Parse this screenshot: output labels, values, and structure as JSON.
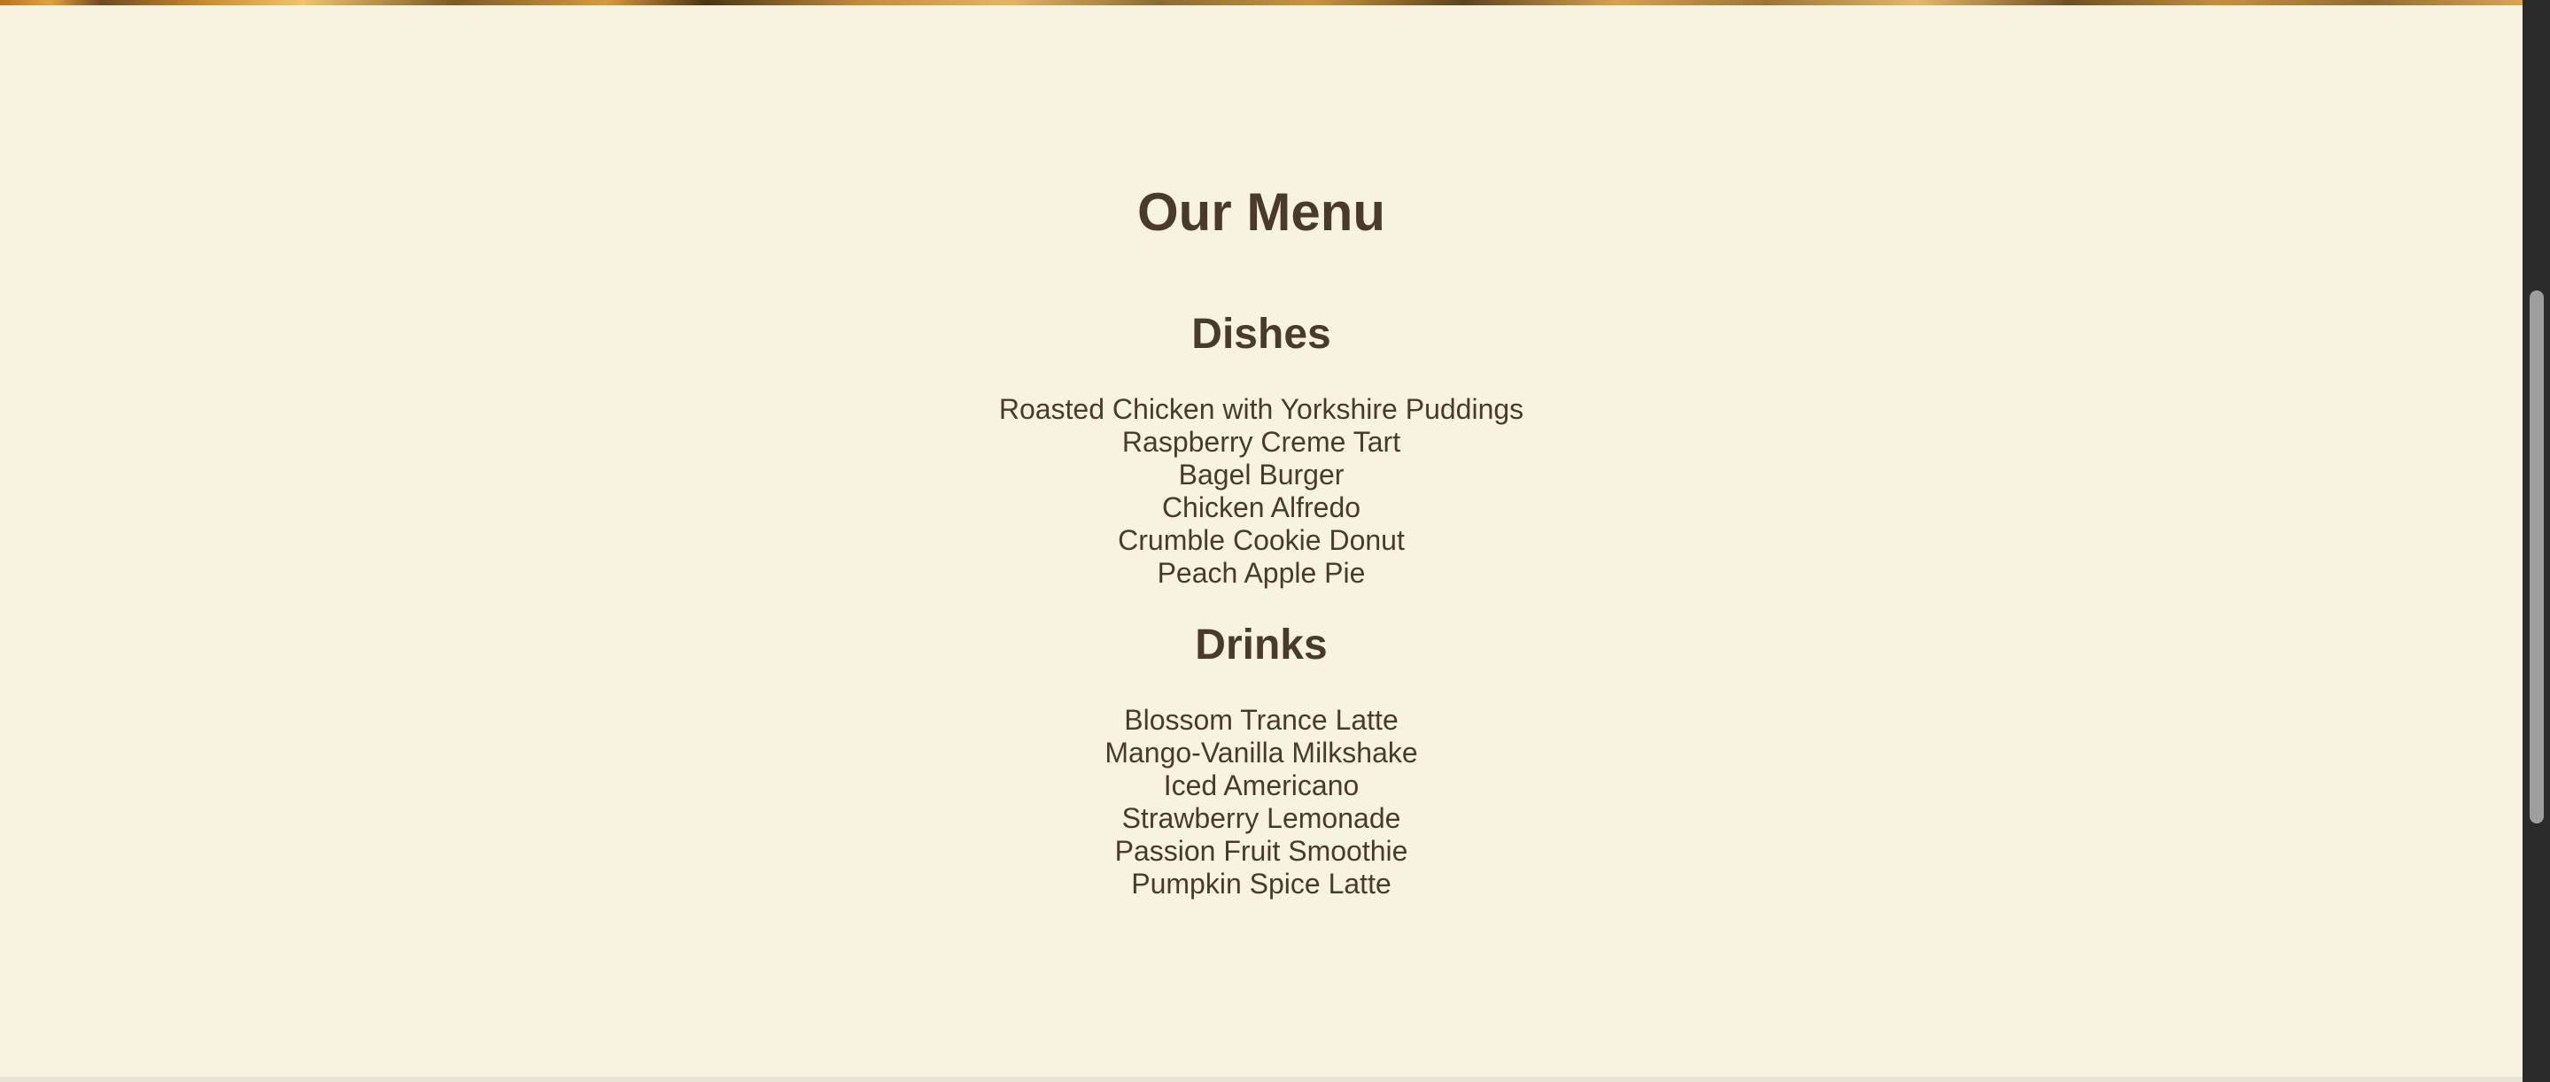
{
  "menu": {
    "title": "Our Menu",
    "dishes": {
      "heading": "Dishes",
      "items": [
        "Roasted Chicken with Yorkshire Puddings",
        "Raspberry Creme Tart",
        "Bagel Burger",
        "Chicken Alfredo",
        "Crumble Cookie Donut",
        "Peach Apple Pie"
      ]
    },
    "drinks": {
      "heading": "Drinks",
      "items": [
        "Blossom Trance Latte",
        "Mango-Vanilla Milkshake",
        "Iced Americano",
        "Strawberry Lemonade",
        "Passion Fruit Smoothie",
        "Pumpkin Spice Latte"
      ]
    }
  },
  "colors": {
    "background": "#f8f2e1",
    "text": "#4a3a2e",
    "scrollbar_track": "#2b2b2b",
    "scrollbar_thumb": "#9e9e9e"
  }
}
